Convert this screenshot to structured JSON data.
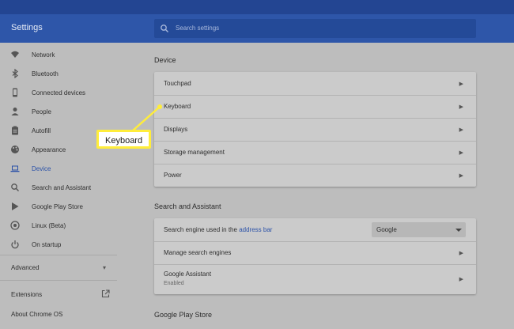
{
  "header": {
    "title": "Settings",
    "search_placeholder": "Search settings",
    "search_icon": "search-icon"
  },
  "colors": {
    "header": "#2e56a9",
    "header_dark": "#234592",
    "accent": "#2a51a8",
    "callout": "#ffed3b"
  },
  "sidebar": {
    "items": [
      {
        "label": "Network",
        "icon": "wifi-icon"
      },
      {
        "label": "Bluetooth",
        "icon": "bluetooth-icon"
      },
      {
        "label": "Connected devices",
        "icon": "phone-icon"
      },
      {
        "label": "People",
        "icon": "person-icon"
      },
      {
        "label": "Autofill",
        "icon": "clipboard-icon"
      },
      {
        "label": "Appearance",
        "icon": "palette-icon"
      },
      {
        "label": "Device",
        "icon": "laptop-icon",
        "active": true
      },
      {
        "label": "Search and Assistant",
        "icon": "search-icon"
      },
      {
        "label": "Google Play Store",
        "icon": "play-store-icon"
      },
      {
        "label": "Linux (Beta)",
        "icon": "linux-icon"
      },
      {
        "label": "On startup",
        "icon": "power-icon"
      }
    ],
    "advanced": "Advanced",
    "extensions": "Extensions",
    "about": "About Chrome OS"
  },
  "device": {
    "title": "Device",
    "items": [
      "Touchpad",
      "Keyboard",
      "Displays",
      "Storage management",
      "Power"
    ]
  },
  "search_assistant": {
    "title": "Search and Assistant",
    "engine_label": "Search engine used in the",
    "engine_link": "address bar",
    "engine_value": "Google",
    "manage": "Manage search engines",
    "assistant": "Google Assistant",
    "assistant_status": "Enabled"
  },
  "play_store": {
    "title": "Google Play Store"
  },
  "callout": {
    "text": "Keyboard"
  }
}
